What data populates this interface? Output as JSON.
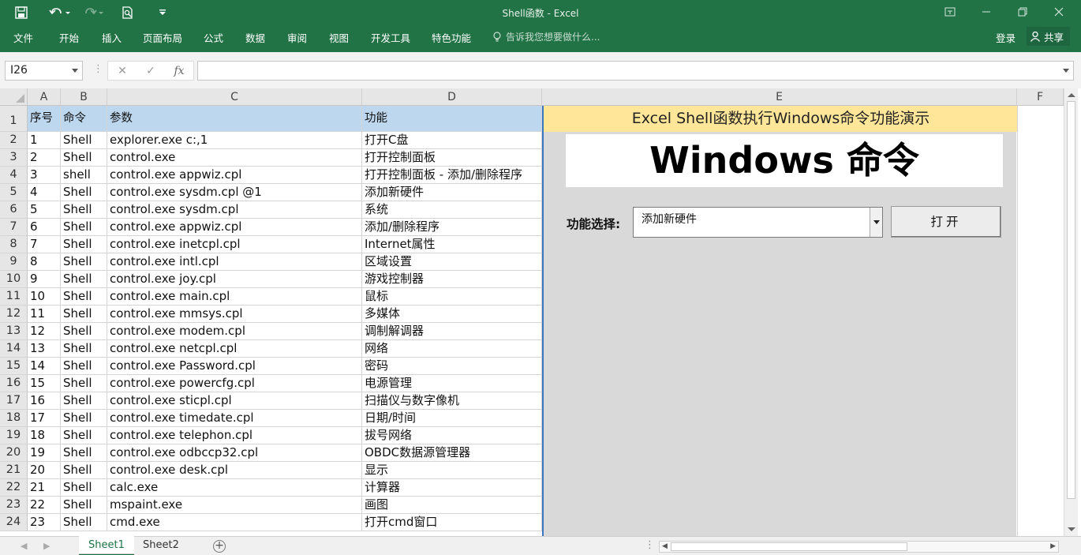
{
  "title": "Shell函数 - Excel",
  "ribbon": {
    "tabs": [
      "文件",
      "开始",
      "插入",
      "页面布局",
      "公式",
      "数据",
      "审阅",
      "视图",
      "开发工具",
      "特色功能"
    ],
    "tell_me": "告诉我您想要做什么...",
    "login": "登录",
    "share": "共享"
  },
  "formula_bar": {
    "name_box": "I26",
    "content": ""
  },
  "columns": [
    "A",
    "B",
    "C",
    "D",
    "E",
    "F"
  ],
  "row_numbers": [
    "1",
    "2",
    "3",
    "4",
    "5",
    "6",
    "7",
    "8",
    "9",
    "10",
    "11",
    "12",
    "13",
    "14",
    "15",
    "16",
    "17",
    "18",
    "19",
    "20",
    "21",
    "22",
    "23",
    "24"
  ],
  "table": {
    "headers": [
      "序号",
      "命令",
      "参数",
      "功能"
    ],
    "rows": [
      [
        "1",
        "Shell",
        "explorer.exe c:,1",
        "打开C盘"
      ],
      [
        "2",
        "Shell",
        "control.exe",
        "打开控制面板"
      ],
      [
        "3",
        "shell",
        "control.exe appwiz.cpl",
        "打开控制面板 - 添加/删除程序"
      ],
      [
        "4",
        "Shell",
        "control.exe sysdm.cpl @1",
        "添加新硬件"
      ],
      [
        "5",
        "Shell",
        "control.exe sysdm.cpl",
        "系统"
      ],
      [
        "6",
        "Shell",
        "control.exe appwiz.cpl",
        "添加/删除程序"
      ],
      [
        "7",
        "Shell",
        "control.exe inetcpl.cpl",
        "Internet属性"
      ],
      [
        "8",
        "Shell",
        "control.exe intl.cpl",
        "区域设置"
      ],
      [
        "9",
        "Shell",
        "control.exe joy.cpl",
        "游戏控制器"
      ],
      [
        "10",
        "Shell",
        "control.exe main.cpl",
        "鼠标"
      ],
      [
        "11",
        "Shell",
        "control.exe mmsys.cpl",
        "多媒体"
      ],
      [
        "12",
        "Shell",
        "control.exe modem.cpl",
        "调制解调器"
      ],
      [
        "13",
        "Shell",
        "control.exe netcpl.cpl",
        "网络"
      ],
      [
        "14",
        "Shell",
        "control.exe Password.cpl",
        "密码"
      ],
      [
        "15",
        "Shell",
        "control.exe powercfg.cpl",
        "电源管理"
      ],
      [
        "16",
        "Shell",
        "control.exe sticpl.cpl",
        "扫描仪与数字像机"
      ],
      [
        "17",
        "Shell",
        "control.exe timedate.cpl",
        "日期/时间"
      ],
      [
        "18",
        "Shell",
        "control.exe telephon.cpl",
        "拔号网络"
      ],
      [
        "19",
        "Shell",
        "control.exe odbccp32.cpl",
        "OBDC数据源管理器"
      ],
      [
        "20",
        "Shell",
        "control.exe desk.cpl",
        "显示"
      ],
      [
        "21",
        "Shell",
        "calc.exe",
        "计算器"
      ],
      [
        "22",
        "Shell",
        "mspaint.exe",
        "画图"
      ],
      [
        "23",
        "Shell",
        "cmd.exe",
        "打开cmd窗口"
      ]
    ]
  },
  "panel": {
    "banner": "Excel Shell函数执行Windows命令功能演示",
    "heading": "Windows 命令",
    "select_label": "功能选择:",
    "selected_value": "添加新硬件",
    "button_label": "打开"
  },
  "sheets": [
    "Sheet1",
    "Sheet2"
  ],
  "colors": {
    "accent": "#217346",
    "header_fill": "#bdd7ee",
    "banner_fill": "#ffe699",
    "panel_fill": "#d9d9d9"
  }
}
